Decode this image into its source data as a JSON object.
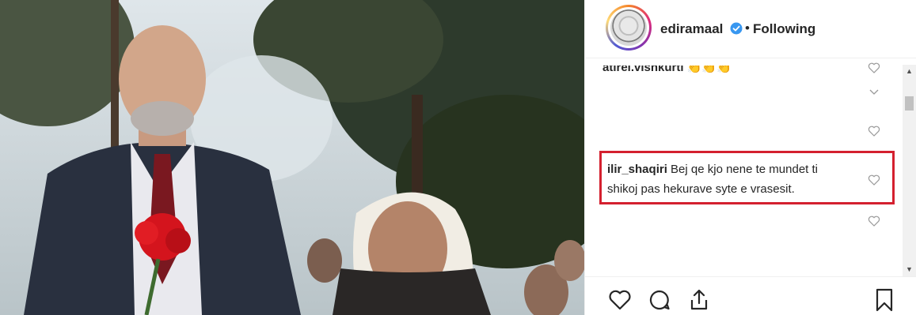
{
  "header": {
    "username": "ediramaal",
    "separator": "•",
    "follow_status": "Following",
    "verified_icon": "verified-badge-icon",
    "verified_color": "#3897f0"
  },
  "comments": {
    "partial_top": {
      "username": "atirel.vishkurti",
      "emoji": "👏👏👏"
    },
    "highlighted": {
      "username": "ilir_shaqiri",
      "text": "Bej qe kjo nene te mundet ti shikoj pas hekurave syte e vrasesit."
    },
    "highlight_color": "#d4202f"
  },
  "actions": {
    "like_icon": "heart-icon",
    "comment_icon": "comment-icon",
    "share_icon": "share-icon",
    "save_icon": "bookmark-icon"
  },
  "scrollbar": {
    "up_glyph": "▲",
    "down_glyph": "▼"
  }
}
